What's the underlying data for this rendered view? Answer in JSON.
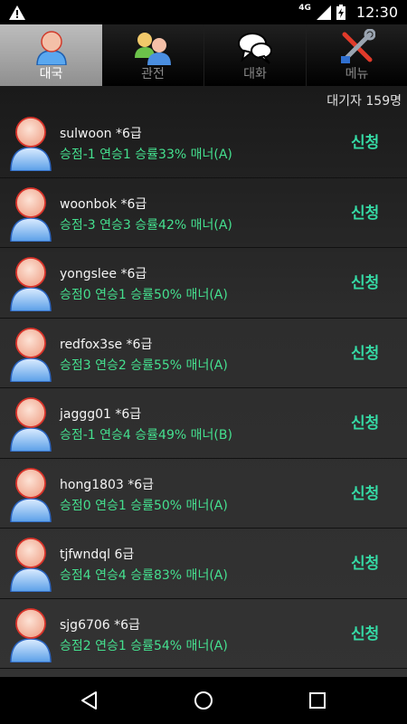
{
  "status_bar": {
    "network": "4G",
    "time": "12:30",
    "icons": [
      "warning-icon",
      "signal-icon",
      "battery-charging-icon"
    ]
  },
  "tabs": [
    {
      "label": "대국",
      "icon": "single-user-icon",
      "active": true
    },
    {
      "label": "관전",
      "icon": "group-users-icon",
      "active": false
    },
    {
      "label": "대화",
      "icon": "chat-bubbles-icon",
      "active": false
    },
    {
      "label": "메뉴",
      "icon": "tools-icon",
      "active": false
    }
  ],
  "waiting_count": "대기자 159명",
  "players": [
    {
      "name": "sulwoon *6급",
      "stats": "승점-1 연승1 승률33% 매너(A)",
      "action": "신청"
    },
    {
      "name": "woonbok *6급",
      "stats": "승점-3 연승3 승률42% 매너(A)",
      "action": "신청"
    },
    {
      "name": "yongslee *6급",
      "stats": "승점0 연승1 승률50% 매너(A)",
      "action": "신청"
    },
    {
      "name": "redfox3se *6급",
      "stats": "승점3 연승2 승률55% 매너(A)",
      "action": "신청"
    },
    {
      "name": "jaggg01 *6급",
      "stats": "승점-1 연승4 승률49% 매너(B)",
      "action": "신청"
    },
    {
      "name": "hong1803 *6급",
      "stats": "승점0 연승1 승률50% 매너(A)",
      "action": "신청"
    },
    {
      "name": "tjfwndql 6급",
      "stats": "승점4 연승4 승률83% 매너(A)",
      "action": "신청"
    },
    {
      "name": "sjg6706 *6급",
      "stats": "승점2 연승1 승률54% 매너(A)",
      "action": "신청"
    },
    {
      "name": "",
      "stats": "",
      "action": ""
    }
  ],
  "nav": [
    "back-icon",
    "home-icon",
    "recents-icon"
  ],
  "colors": {
    "stats": "#45e08f",
    "apply": "#35d9a4",
    "active_tab": "#b0b0b0"
  }
}
